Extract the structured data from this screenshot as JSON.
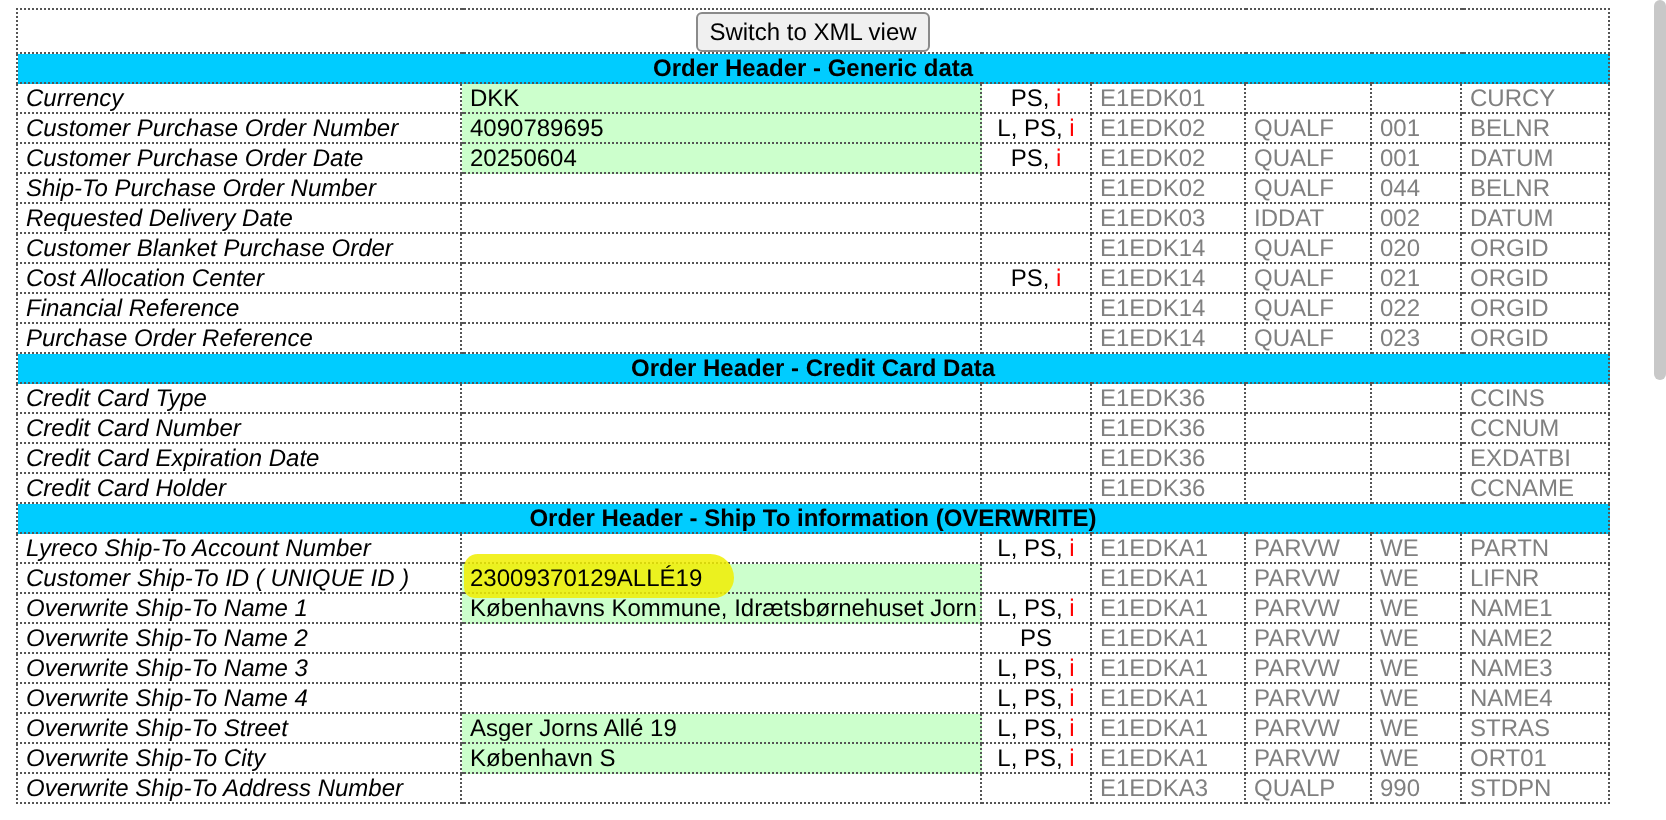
{
  "toolbar": {
    "button": "Switch to XML view"
  },
  "sections": [
    {
      "title": "Order Header - Generic data",
      "rows": [
        {
          "label": "Currency",
          "value": "DKK",
          "flags": [
            {
              "text": "PS, ",
              "color": "#000000"
            },
            {
              "text": "i",
              "color": "#ff0000"
            }
          ],
          "segment": "E1EDK01",
          "field": "CURCY"
        },
        {
          "label": "Customer Purchase Order Number",
          "value": "4090789695",
          "flags": [
            {
              "text": "L, PS, ",
              "color": "#000000"
            },
            {
              "text": "i",
              "color": "#ff0000"
            }
          ],
          "segment": "E1EDK02",
          "qualifier": "QUALF",
          "qualifier_value": "001",
          "field": "BELNR"
        },
        {
          "label": "Customer Purchase Order Date",
          "value": "20250604",
          "flags": [
            {
              "text": "PS, ",
              "color": "#000000"
            },
            {
              "text": "i",
              "color": "#ff0000"
            }
          ],
          "segment": "E1EDK02",
          "qualifier": "QUALF",
          "qualifier_value": "001",
          "field": "DATUM"
        },
        {
          "label": "Ship-To Purchase Order Number",
          "segment": "E1EDK02",
          "qualifier": "QUALF",
          "qualifier_value": "044",
          "field": "BELNR"
        },
        {
          "label": "Requested Delivery Date",
          "segment": "E1EDK03",
          "qualifier": "IDDAT",
          "qualifier_value": "002",
          "field": "DATUM"
        },
        {
          "label": "Customer Blanket Purchase Order",
          "segment": "E1EDK14",
          "qualifier": "QUALF",
          "qualifier_value": "020",
          "field": "ORGID"
        },
        {
          "label": "Cost Allocation Center",
          "flags": [
            {
              "text": "PS, ",
              "color": "#000000"
            },
            {
              "text": "i",
              "color": "#ff0000"
            }
          ],
          "segment": "E1EDK14",
          "qualifier": "QUALF",
          "qualifier_value": "021",
          "field": "ORGID"
        },
        {
          "label": "Financial Reference",
          "segment": "E1EDK14",
          "qualifier": "QUALF",
          "qualifier_value": "022",
          "field": "ORGID"
        },
        {
          "label": "Purchase Order Reference",
          "segment": "E1EDK14",
          "qualifier": "QUALF",
          "qualifier_value": "023",
          "field": "ORGID"
        }
      ]
    },
    {
      "title": "Order Header - Credit Card Data",
      "rows": [
        {
          "label": "Credit Card Type",
          "segment": "E1EDK36",
          "field": "CCINS"
        },
        {
          "label": "Credit Card Number",
          "segment": "E1EDK36",
          "field": "CCNUM"
        },
        {
          "label": "Credit Card Expiration Date",
          "segment": "E1EDK36",
          "field": "EXDATBI"
        },
        {
          "label": "Credit Card Holder",
          "segment": "E1EDK36",
          "field": "CCNAME"
        }
      ]
    },
    {
      "title": "Order Header - Ship To information (OVERWRITE)",
      "rows": [
        {
          "label": "Lyreco Ship-To Account Number",
          "flags": [
            {
              "text": "L, PS, ",
              "color": "#000000"
            },
            {
              "text": "i",
              "color": "#ff0000"
            }
          ],
          "segment": "E1EDKA1",
          "qualifier": "PARVW",
          "qualifier_value": "WE",
          "field": "PARTN"
        },
        {
          "label": "Customer Ship-To ID ( UNIQUE ID )",
          "value": "23009370129ALLÉ19",
          "highlighted": true,
          "segment": "E1EDKA1",
          "qualifier": "PARVW",
          "qualifier_value": "WE",
          "field": "LIFNR"
        },
        {
          "label": "Overwrite Ship-To Name 1",
          "value": "Københavns Kommune, Idrætsbørnehuset Jorn",
          "flags": [
            {
              "text": "L, PS, ",
              "color": "#000000"
            },
            {
              "text": "i",
              "color": "#ff0000"
            }
          ],
          "segment": "E1EDKA1",
          "qualifier": "PARVW",
          "qualifier_value": "WE",
          "field": "NAME1"
        },
        {
          "label": "Overwrite Ship-To Name 2",
          "flags": [
            {
              "text": "PS",
              "color": "#000000"
            }
          ],
          "segment": "E1EDKA1",
          "qualifier": "PARVW",
          "qualifier_value": "WE",
          "field": "NAME2"
        },
        {
          "label": "Overwrite Ship-To Name 3",
          "flags": [
            {
              "text": "L, PS, ",
              "color": "#000000"
            },
            {
              "text": "i",
              "color": "#ff0000"
            }
          ],
          "segment": "E1EDKA1",
          "qualifier": "PARVW",
          "qualifier_value": "WE",
          "field": "NAME3"
        },
        {
          "label": "Overwrite Ship-To Name 4",
          "flags": [
            {
              "text": "L, PS, ",
              "color": "#000000"
            },
            {
              "text": "i",
              "color": "#ff0000"
            }
          ],
          "segment": "E1EDKA1",
          "qualifier": "PARVW",
          "qualifier_value": "WE",
          "field": "NAME4"
        },
        {
          "label": "Overwrite Ship-To Street",
          "value": "Asger Jorns Allé 19",
          "flags": [
            {
              "text": "L, PS, ",
              "color": "#000000"
            },
            {
              "text": "i",
              "color": "#ff0000"
            }
          ],
          "segment": "E1EDKA1",
          "qualifier": "PARVW",
          "qualifier_value": "WE",
          "field": "STRAS"
        },
        {
          "label": "Overwrite Ship-To City",
          "value": "København S",
          "flags": [
            {
              "text": "L, PS, ",
              "color": "#000000"
            },
            {
              "text": "i",
              "color": "#ff0000"
            }
          ],
          "segment": "E1EDKA1",
          "qualifier": "PARVW",
          "qualifier_value": "WE",
          "field": "ORT01"
        },
        {
          "label": "Overwrite Ship-To Address Number",
          "segment": "E1EDKA3",
          "qualifier": "QUALP",
          "qualifier_value": "990",
          "field": "STDPN"
        }
      ]
    }
  ]
}
